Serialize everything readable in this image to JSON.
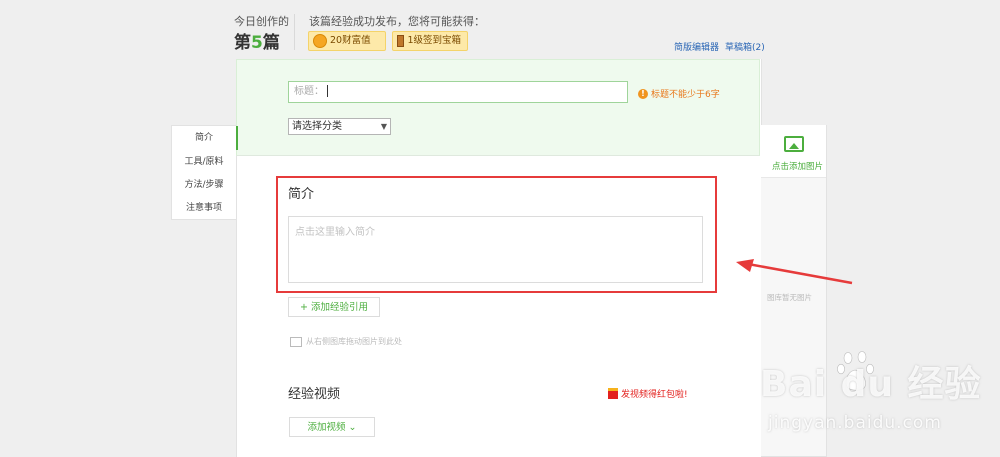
{
  "header": {
    "today_label": "今日创作的",
    "count_prefix": "第",
    "count_number": "5",
    "count_suffix": "篇",
    "reward_title": "该篇经验成功发布，您将可能获得：",
    "rewards": [
      {
        "label": "20财富值",
        "icon": "coin-icon"
      },
      {
        "label": "1级签到宝箱",
        "icon": "chest-icon"
      }
    ],
    "simple_editor_link": "简版编辑器",
    "drafts_link": "草稿箱(2)"
  },
  "form": {
    "title_placeholder": "标题：",
    "title_warning": "标题不能少于6字",
    "category_select": "请选择分类"
  },
  "leftnav": {
    "items": [
      "简介",
      "工具/原料",
      "方法/步骤",
      "注意事项"
    ],
    "active_index": 0
  },
  "intro": {
    "title": "简介",
    "placeholder": "点击这里输入简介",
    "add_reference": "+ 添加经验引用",
    "drag_hint": "从右侧图库拖动图片到此处"
  },
  "video": {
    "title": "经验视频",
    "promo": "发视频得红包啦!",
    "add_video": "添加视频 ⌄"
  },
  "image_panel": {
    "add_image": "点击添加图片",
    "empty_text": "图库暂无图片"
  },
  "watermark": {
    "main": "Bai du 经验",
    "sub": "jingyan.baidu.com"
  },
  "colors": {
    "accent": "#4cae3e",
    "annotation_red": "#e63b3b",
    "warning": "#e8781b"
  }
}
